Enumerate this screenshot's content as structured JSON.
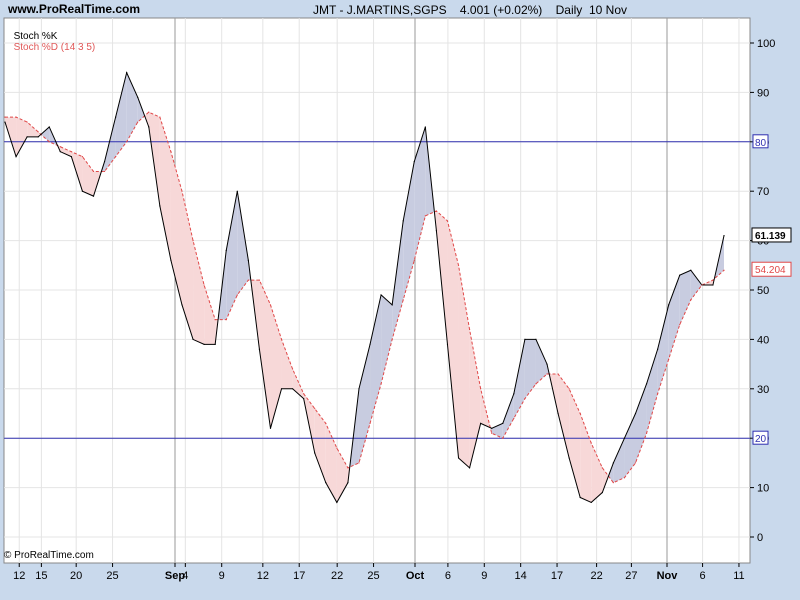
{
  "header": {
    "site": "www.ProRealTime.com",
    "title": "JMT - J.MARTINS,SGPS    4.001 (+0.02%)    Daily  10 Nov"
  },
  "legend": {
    "k_label": "Stoch %K",
    "d_label": "Stoch %D (14 3 5)"
  },
  "copyright": "© ProRealTime.com",
  "colors": {
    "k_line": "#000000",
    "d_line": "#e04848",
    "fill_up": "#c8cce0",
    "fill_down": "#f7d8d8",
    "ref_line": "#3030b0",
    "background": "#c9d9ec",
    "plot_bg": "#ffffff"
  },
  "chart_data": {
    "type": "line",
    "title": "JMT - J.MARTINS,SGPS 4.001 (+0.02%) Daily 10 Nov",
    "xlabel": "",
    "ylabel": "",
    "ylim": [
      -6,
      102
    ],
    "grid": true,
    "y_ticks": [
      "0",
      "10",
      "20",
      "30",
      "40",
      "50",
      "60",
      "70",
      "80",
      "90",
      "100"
    ],
    "x_ticks": [
      "12",
      "15",
      "20",
      "25",
      "Sep",
      "4",
      "9",
      "12",
      "17",
      "22",
      "25",
      "Oct",
      "6",
      "9",
      "14",
      "17",
      "22",
      "27",
      "Nov",
      "6",
      "11"
    ],
    "reference_lines": [
      {
        "value": 80,
        "label": "80"
      },
      {
        "value": 20,
        "label": "20"
      }
    ],
    "last_values": {
      "k": "61.139",
      "d": "54.204"
    },
    "series": [
      {
        "name": "Stoch %K",
        "values": [
          84,
          77,
          81,
          81,
          83,
          78,
          77,
          70,
          69,
          76,
          85,
          94,
          89,
          83,
          67,
          56,
          47,
          40,
          39,
          39,
          58,
          70,
          56,
          38,
          22,
          30,
          30,
          28,
          17,
          11,
          7,
          11,
          30,
          39,
          49,
          47,
          64,
          76,
          83,
          62,
          39,
          16,
          14,
          23,
          22,
          23,
          29,
          40,
          40,
          35,
          25,
          16,
          8,
          7,
          9,
          15,
          20,
          25,
          31,
          38,
          47,
          53,
          54,
          51,
          51,
          61
        ]
      },
      {
        "name": "Stoch %D (14 3 5)",
        "values": [
          85,
          85,
          84,
          82,
          80,
          79,
          78,
          77,
          74,
          74,
          77,
          80,
          84,
          86,
          85,
          78,
          70,
          60,
          51,
          44,
          44,
          49,
          52,
          52,
          47,
          40,
          34,
          29,
          26,
          23,
          18,
          14,
          15,
          23,
          31,
          40,
          48,
          56,
          65,
          66,
          64,
          55,
          42,
          30,
          21,
          20,
          24,
          28,
          31,
          33,
          33,
          30,
          25,
          19,
          14,
          11,
          12,
          15,
          21,
          29,
          36,
          43,
          48,
          51,
          52,
          54
        ]
      }
    ]
  }
}
